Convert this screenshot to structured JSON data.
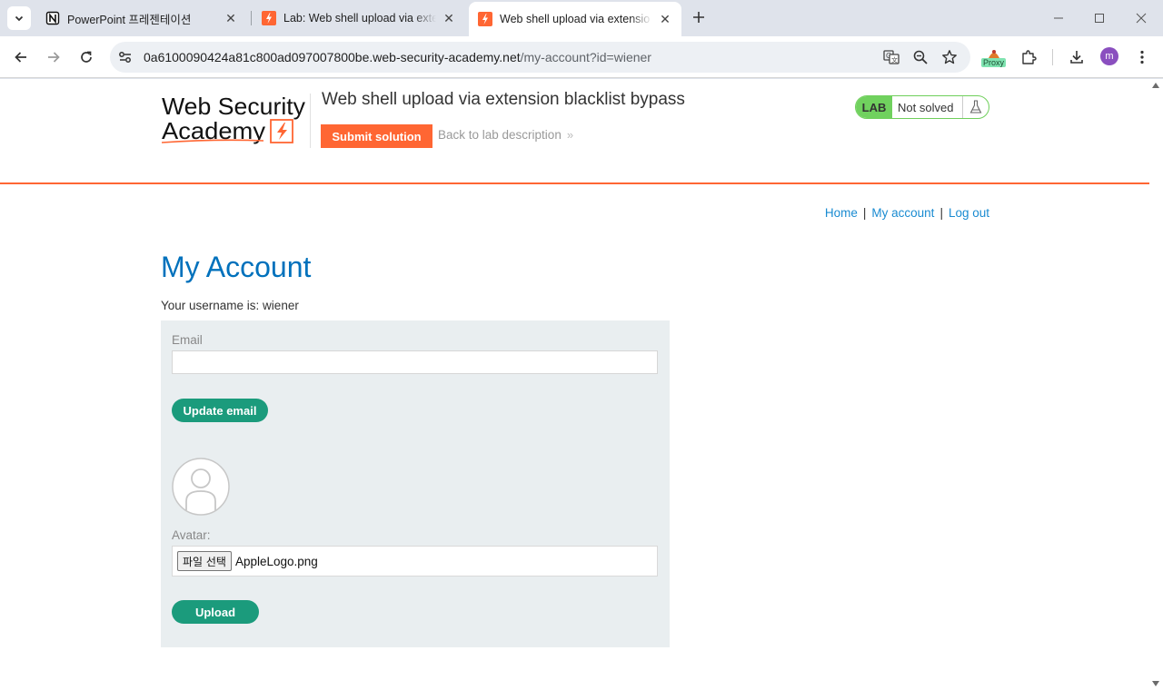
{
  "browser": {
    "tabs": [
      {
        "title": "PowerPoint 프레젠테이션",
        "favicon": "notion-icon",
        "active": false
      },
      {
        "title": "Lab: Web shell upload via exte",
        "favicon": "portswigger-icon",
        "active": false
      },
      {
        "title": "Web shell upload via extensio",
        "favicon": "portswigger-icon",
        "active": true
      }
    ],
    "url_host": "0a6100090424a81c800ad097007800be.web-security-academy.net",
    "url_path": "/my-account?id=wiener",
    "extension_badge": "Proxy",
    "profile_initial": "m"
  },
  "lab": {
    "logo_line1": "Web Security",
    "logo_line2": "Academy",
    "title": "Web shell upload via extension blacklist bypass",
    "submit_label": "Submit solution",
    "back_label": "Back to lab description",
    "badge_lab": "LAB",
    "badge_status": "Not solved"
  },
  "nav": {
    "home": "Home",
    "separator": "|",
    "my_account": "My account",
    "log_out": "Log out"
  },
  "account": {
    "heading": "My Account",
    "username_line": "Your username is: wiener",
    "email_label": "Email",
    "email_value": "",
    "update_email_label": "Update email",
    "avatar_label": "Avatar:",
    "file_button_label": "파일 선택",
    "file_name": "AppleLogo.png",
    "upload_label": "Upload"
  },
  "colors": {
    "accent_orange": "#ff6633",
    "link_blue": "#1a8bd1",
    "title_blue": "#0071bc",
    "button_green": "#1b9b7c",
    "lab_green": "#70d15e",
    "panel_bg": "#e9eef0"
  }
}
